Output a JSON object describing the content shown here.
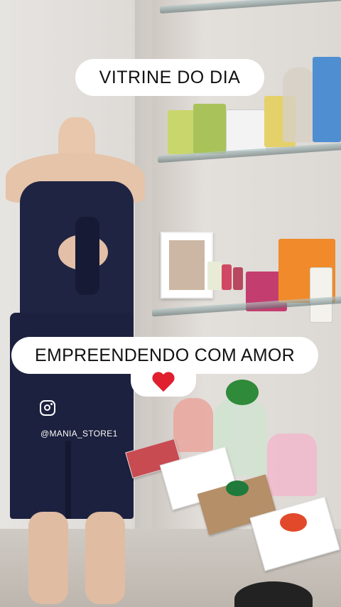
{
  "story": {
    "title_sticker": "VITRINE DO DIA",
    "caption_sticker": "EMPREENDENDO COM AMOR",
    "heart_emoji": "red-heart-icon",
    "instagram_icon": "instagram-icon",
    "handle": "@MANIA_STORE1"
  },
  "colors": {
    "sticker_bg": "#ffffff",
    "sticker_text": "#111111",
    "heart": "#e0202e",
    "jumpsuit": "#1f2442"
  }
}
